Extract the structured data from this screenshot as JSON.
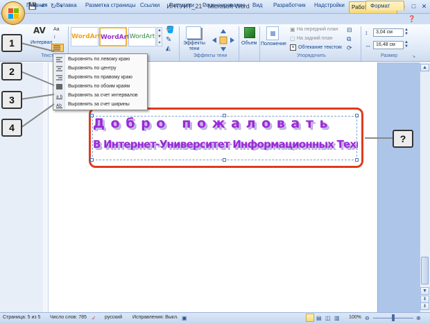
{
  "title_bar": {
    "document_title": "ИНТУИТ_21 - Microsoft Word",
    "context_title": "Работа с объекта...",
    "window_buttons": [
      "–",
      "□",
      "✕"
    ]
  },
  "tabs": [
    {
      "label": "Главная"
    },
    {
      "label": "Вставка"
    },
    {
      "label": "Разметка страницы"
    },
    {
      "label": "Ссылки"
    },
    {
      "label": "Рассылки"
    },
    {
      "label": "Рецензирование"
    },
    {
      "label": "Вид"
    },
    {
      "label": "Разработчик"
    },
    {
      "label": "Надстройки"
    },
    {
      "label": "Формат"
    }
  ],
  "ribbon": {
    "text_group": {
      "spacing_label": "Интервал",
      "group_label": "Текст",
      "av_glyph": "AV",
      "aa_glyph": "Aa"
    },
    "wordart_styles": [
      {
        "label": "WordArt",
        "color": "#f2a31b"
      },
      {
        "label": "WordArt",
        "color": "#9a2ad6"
      },
      {
        "label": "WordArt",
        "color": "#2b8a3e"
      }
    ],
    "shadow": {
      "button_label": "Эффекты тени",
      "group_label": "Эффекты тени"
    },
    "volume": {
      "button_label": "Объем"
    },
    "arrange": {
      "position_label": "Положение",
      "to_front": "На передний план",
      "to_back": "На задний план",
      "text_wrap": "Обтекание текстом",
      "group_label": "Упорядочить"
    },
    "size": {
      "height": "3,04 см",
      "width": "16,48 см",
      "group_label": "Размер"
    }
  },
  "menu": {
    "items": [
      {
        "label": "Выровнять по левому краю",
        "icon": "align-left-icon"
      },
      {
        "label": "Выровнять по центру",
        "icon": "align-center-icon"
      },
      {
        "label": "Выровнять по правому краю",
        "icon": "align-right-icon"
      },
      {
        "label": "Выровнять по обоим краям",
        "icon": "align-justify-icon"
      },
      {
        "label": "Выровнять за счет интервалов",
        "icon": "stretch-spacing-icon"
      },
      {
        "label": "Выровнять за счет ширины",
        "icon": "stretch-width-icon"
      }
    ]
  },
  "callouts": [
    "1",
    "2",
    "3",
    "4",
    "?"
  ],
  "wordart": {
    "line1": "Д о б р о   п о ж а л о в а т ь",
    "line2": "В Интернет-Университет Информационных Технологий!",
    "fill_color": "#9a2ad6",
    "outline_color": "#e03a1c"
  },
  "status_bar": {
    "page": "Страница: 5 из 5",
    "words": "Число слов: 785",
    "language": "русский",
    "track_changes": "Исправления: Выкл.",
    "zoom": "100%"
  }
}
